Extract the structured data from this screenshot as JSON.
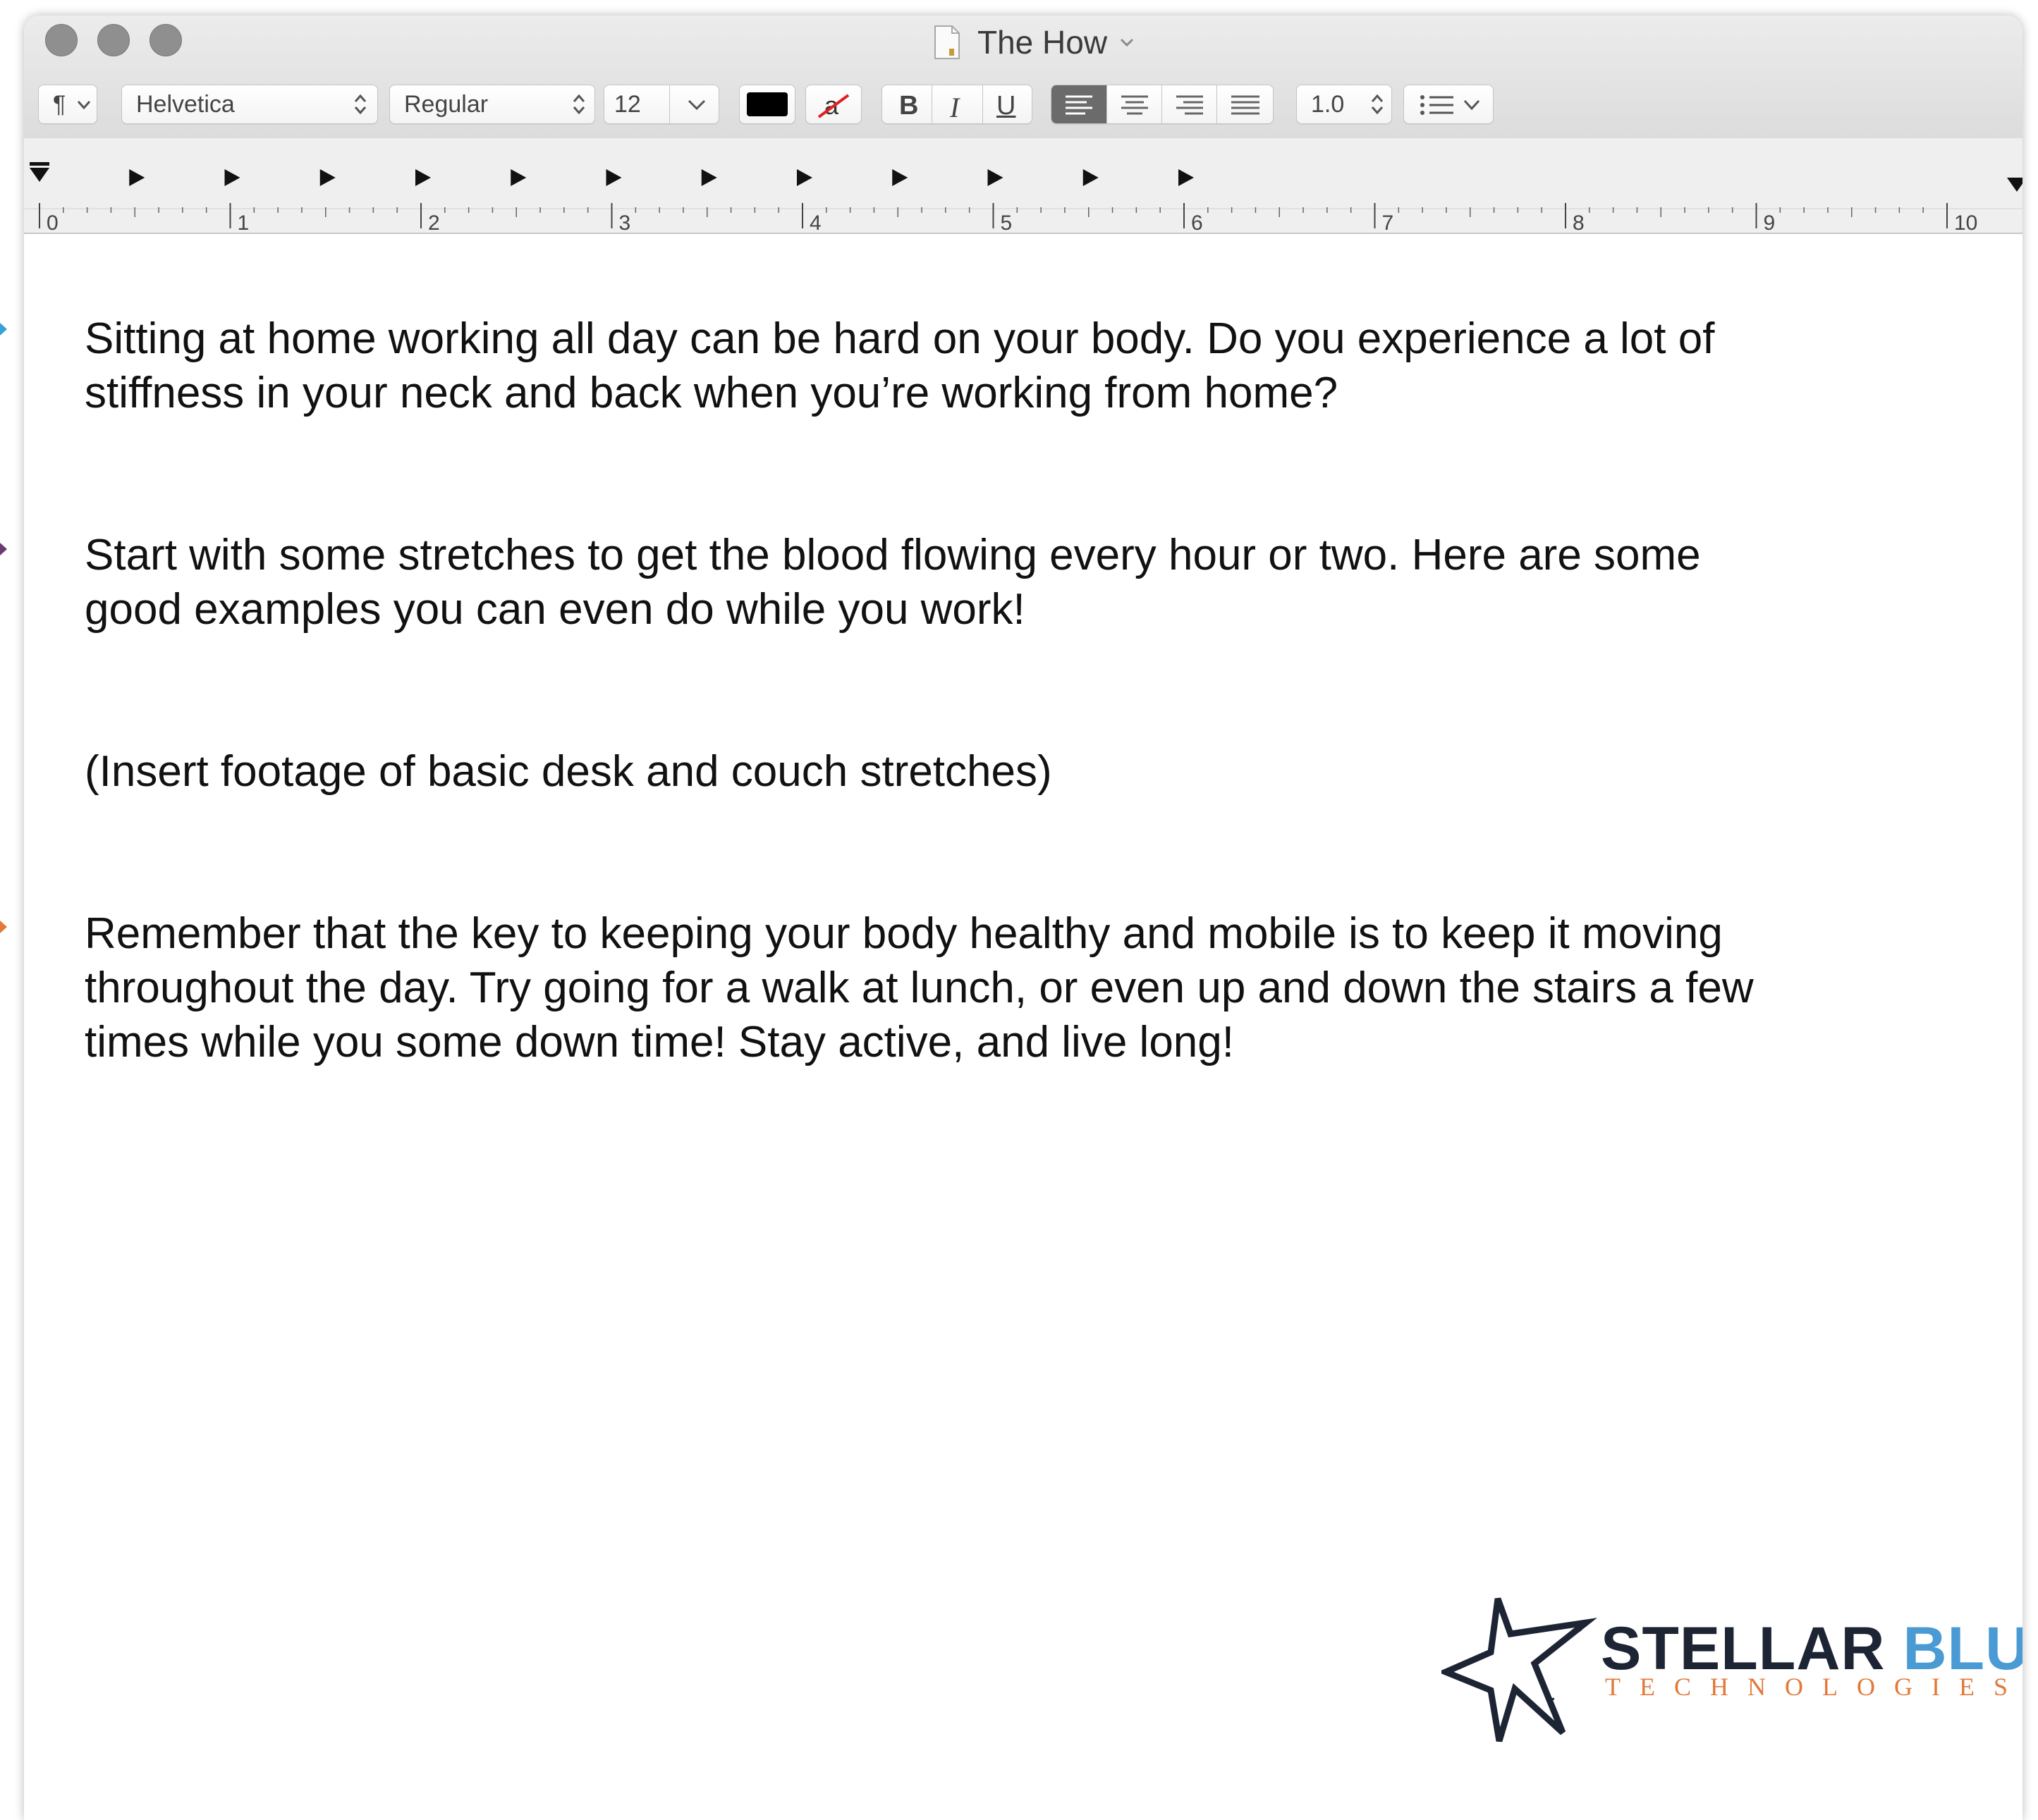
{
  "window": {
    "title": "The How"
  },
  "toolbar": {
    "paragraph_style": "¶",
    "font_family": "Helvetica",
    "font_style": "Regular",
    "font_size": "12",
    "text_color": "#000000",
    "bold_label": "B",
    "italic_label": "I",
    "underline_label": "U",
    "line_spacing": "1.0"
  },
  "ruler": {
    "numbers": [
      "0",
      "1",
      "2",
      "3",
      "4",
      "5",
      "6",
      "7",
      "8",
      "9",
      "10"
    ]
  },
  "document": {
    "paragraphs": [
      "Sitting at home working all day can be hard on your body. Do you experience a lot of\nstiffness in your neck and back when you’re working from home?",
      "Start with some stretches to get the blood flowing every hour or two. Here are some\ngood examples you can even do while you work!",
      "(Insert footage of basic desk and couch stretches)",
      "Remember that the key to keeping your body healthy and mobile is to keep it moving\nthroughout the day. Try going for a walk at lunch, or even up and down the stairs a few\ntimes while you some down time! Stay active, and live long!"
    ]
  },
  "logo": {
    "word1": "STELLAR",
    "word2": "BLUE",
    "tagline": "TECHNOLOGIES",
    "color_dark": "#1d2433",
    "color_blue": "#4a9ad4",
    "color_orange": "#e2793a"
  }
}
